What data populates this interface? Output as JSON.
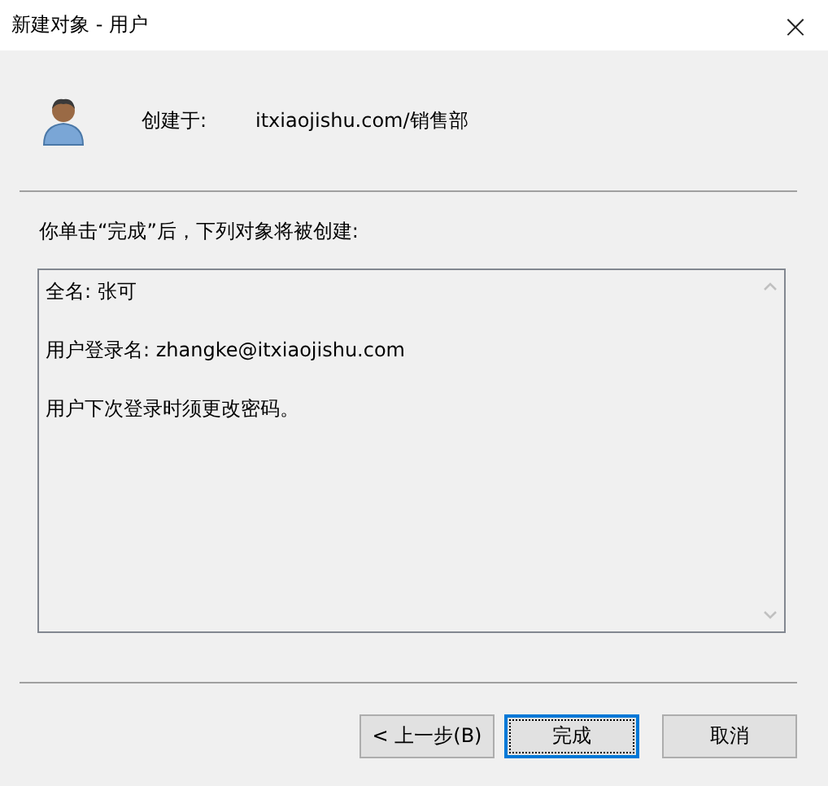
{
  "window": {
    "title": "新建对象 - 用户",
    "close": "×"
  },
  "header": {
    "label": "创建于:",
    "value": "itxiaojishu.com/销售部"
  },
  "intro": "你单击“完成”后，下列对象将被创建:",
  "summary": [
    "全名: 张可",
    "用户登录名: zhangke@itxiaojishu.com",
    "用户下次登录时须更改密码。"
  ],
  "buttons": [
    {
      "label": "< 上一步(B)",
      "focused": false
    },
    {
      "label": "完成",
      "focused": true
    },
    {
      "label": "取消",
      "focused": false
    }
  ]
}
